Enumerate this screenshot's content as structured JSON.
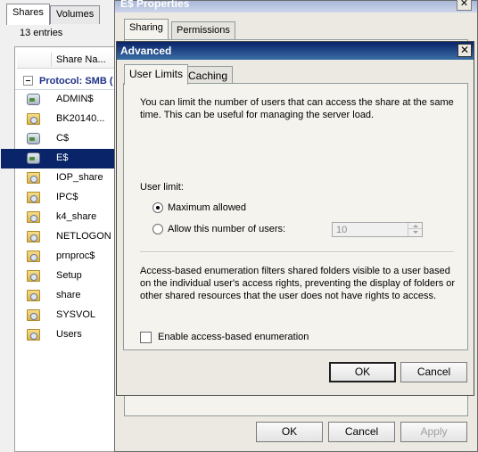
{
  "list_panel": {
    "tabs": [
      "Shares",
      "Volumes"
    ],
    "entries": "13 entries",
    "column_header": "Share Na...",
    "group": "Protocol: SMB (",
    "shares": [
      {
        "name": "ADMIN$",
        "icon": "drive-share-icon"
      },
      {
        "name": "BK20140...",
        "icon": "folder-share-icon"
      },
      {
        "name": "C$",
        "icon": "drive-share-icon"
      },
      {
        "name": "E$",
        "icon": "drive-share-icon",
        "selected": true
      },
      {
        "name": "IOP_share",
        "icon": "folder-share-icon"
      },
      {
        "name": "IPC$",
        "icon": "folder-share-icon"
      },
      {
        "name": "k4_share",
        "icon": "folder-share-icon"
      },
      {
        "name": "NETLOGON",
        "icon": "folder-share-icon"
      },
      {
        "name": "prnproc$",
        "icon": "folder-share-icon"
      },
      {
        "name": "Setup",
        "icon": "folder-share-icon"
      },
      {
        "name": "share",
        "icon": "folder-share-icon"
      },
      {
        "name": "SYSVOL",
        "icon": "folder-share-icon"
      },
      {
        "name": "Users",
        "icon": "folder-share-icon"
      }
    ]
  },
  "properties": {
    "title": "E$ Properties",
    "close": "✕",
    "tabs": [
      "Sharing",
      "Permissions"
    ],
    "buttons": {
      "ok": "OK",
      "cancel": "Cancel",
      "apply": "Apply"
    }
  },
  "advanced": {
    "title": "Advanced",
    "close": "✕",
    "tabs": [
      "User Limits",
      "Caching"
    ],
    "intro": "You can limit the number of users that can access the share at the same time. This can be useful for managing the server load.",
    "user_limit_label": "User limit:",
    "radio_max": "Maximum allowed",
    "radio_allow": "Allow this number of users:",
    "user_count": "10",
    "abe_text": "Access-based enumeration filters shared folders visible to a user based on the individual user's access rights, preventing the display of folders or other shared resources that the user does not have rights to access.",
    "abe_checkbox": "Enable access-based enumeration",
    "buttons": {
      "ok": "OK",
      "cancel": "Cancel"
    }
  }
}
